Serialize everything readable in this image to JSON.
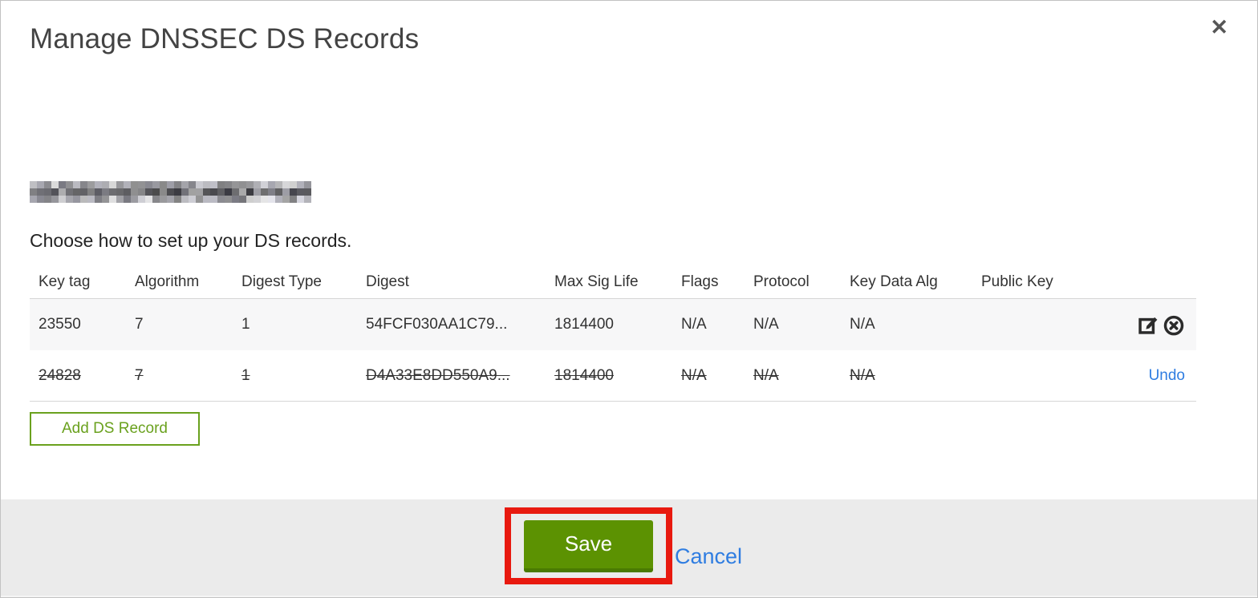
{
  "modal": {
    "title": "Manage DNSSEC DS Records",
    "close_glyph": "✕"
  },
  "instructions": "Choose how to set up your DS records.",
  "table": {
    "columns": [
      "Key tag",
      "Algorithm",
      "Digest Type",
      "Digest",
      "Max Sig Life",
      "Flags",
      "Protocol",
      "Key Data Alg",
      "Public Key"
    ],
    "rows": [
      {
        "key_tag": "23550",
        "algorithm": "7",
        "digest_type": "1",
        "digest": "54FCF030AA1C79...",
        "max_sig_life": "1814400",
        "flags": "N/A",
        "protocol": "N/A",
        "key_data_alg": "N/A",
        "public_key": "",
        "status": "active",
        "action_icons": [
          "edit-icon",
          "circle-x-delete-icon"
        ]
      },
      {
        "key_tag": "24828",
        "algorithm": "7",
        "digest_type": "1",
        "digest": "D4A33E8DD550A9...",
        "max_sig_life": "1814400",
        "flags": "N/A",
        "protocol": "N/A",
        "key_data_alg": "N/A",
        "public_key": "",
        "status": "marked-for-deletion",
        "action_label": "Undo"
      }
    ]
  },
  "buttons": {
    "add_ds_record": "Add DS Record",
    "save": "Save",
    "cancel": "Cancel"
  },
  "annotation": {
    "type": "red-highlight-box",
    "target": "save-button",
    "color": "#e8190f"
  },
  "colors": {
    "save_green": "#5c9202",
    "outline_green": "#6aa11e",
    "link_blue": "#2f7de1",
    "footer_gray": "#ebebeb"
  }
}
